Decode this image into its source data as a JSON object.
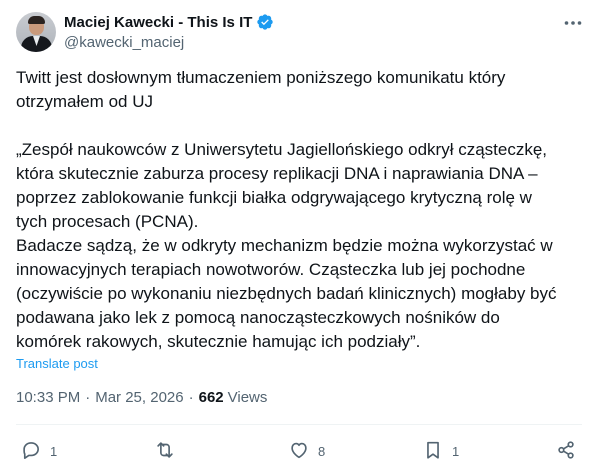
{
  "author": {
    "display_name": "Maciej Kawecki - This Is IT",
    "handle": "@kawecki_maciej"
  },
  "tweet": {
    "paragraphs": [
      "Twitt jest dosłownym tłumaczeniem poniższego komunikatu który\notrzymałem od UJ",
      "„Zespół naukowców z Uniwersytetu Jagiellońskiego odkrył cząsteczkę,\nktóra skutecznie zaburza procesy replikacji DNA i naprawiania DNA –\npoprzez zablokowanie funkcji białka odgrywającego krytyczną rolę w\ntych procesach (PCNA).\nBadacze sądzą, że w odkryty mechanizm będzie można wykorzystać w\ninnowacyjnych terapiach nowotworów. Cząsteczka lub jej pochodne\n(oczywiście po wykonaniu niezbędnych badań klinicznych) mogłaby być\npodawana jako lek z pomocą nanocząsteczkowych nośników do\nkomórek rakowych, skutecznie hamując ich podziały”."
    ],
    "translate_label": "Translate post",
    "time": "10:33 PM",
    "separator": "·",
    "date": "Mar 25, 2026",
    "views_count": "662",
    "views_label": "Views"
  },
  "actions": {
    "replies": "1",
    "reposts": "",
    "likes": "8",
    "bookmarks": "1"
  },
  "colors": {
    "accent": "#1d9bf0",
    "text": "#0f1419",
    "secondary": "#536471"
  }
}
